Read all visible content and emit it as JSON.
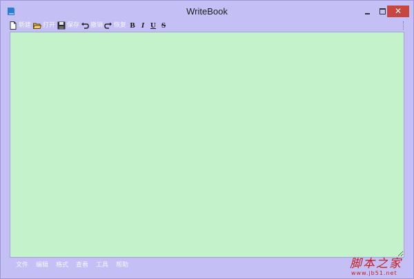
{
  "window": {
    "title": "WriteBook",
    "close_glyph": "✕"
  },
  "toolbar": {
    "buttons": [
      {
        "label": "新建",
        "icon": "new-file-icon"
      },
      {
        "label": "打开",
        "icon": "folder-open-icon"
      },
      {
        "label": "保存",
        "icon": "save-icon"
      },
      {
        "label": "撤销",
        "icon": "undo-icon"
      },
      {
        "label": "恢复",
        "icon": "redo-icon"
      }
    ],
    "format_buttons": [
      {
        "glyph": "B",
        "icon": "bold-icon"
      },
      {
        "glyph": "I",
        "icon": "italic-icon"
      },
      {
        "glyph": "U",
        "icon": "underline-icon"
      },
      {
        "glyph": "S",
        "icon": "strikethrough-icon"
      }
    ]
  },
  "editor": {
    "content": ""
  },
  "menubar": {
    "items": [
      "文件",
      "编辑",
      "格式",
      "查看",
      "工具",
      "帮助"
    ]
  },
  "watermark": {
    "main": "脚本之家",
    "sub": "www.jb51.net"
  },
  "colors": {
    "window_bg": "#c4c0f6",
    "editor_bg": "#c4f2ca",
    "close_bg": "#c7463f",
    "watermark": "#c21c1c"
  }
}
